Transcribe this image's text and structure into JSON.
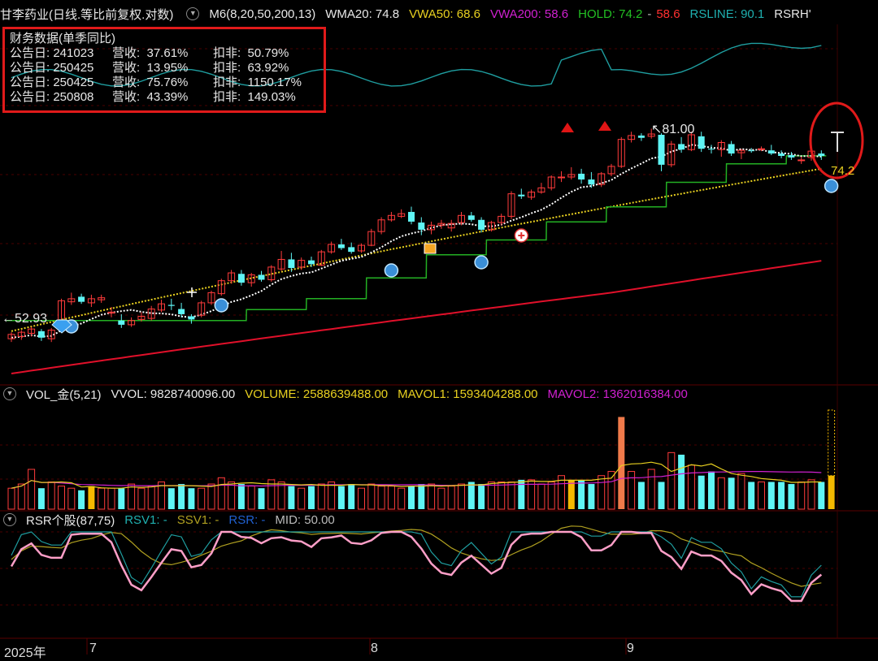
{
  "header": {
    "title": "甘李药业(日线.等比前复权.对数)",
    "m6": "M6(8,20,50,200,13)",
    "wma20": "WMA20: 74.8",
    "vwa50": "VWA50: 68.6",
    "vwa200": "VWA200: 58.6",
    "hold_a": "HOLD: 74.2",
    "hold_b": "58.6",
    "rsline": "RSLINE: 90.1",
    "rsrh": "RSRH'"
  },
  "financial": {
    "title": "财务数据(单季同比)",
    "rows": [
      {
        "date": "公告日: 241023",
        "rev": "营收:  37.61%",
        "np": "扣非:  50.79%"
      },
      {
        "date": "公告日: 250425",
        "rev": "营收:  13.95%",
        "np": "扣非:  63.92%"
      },
      {
        "date": "公告日: 250425",
        "rev": "营收:  75.76%",
        "np": "扣非:  1150.17%"
      },
      {
        "date": "公告日: 250808",
        "rev": "营收:  43.39%",
        "np": "扣非:  149.03%"
      }
    ]
  },
  "annotations": {
    "high": "81.00",
    "low": "52.93",
    "last": "74.2"
  },
  "volume": {
    "label": "VOL_金(5,21)",
    "vvol": "VVOL: 9828740096.00",
    "volume": "VOLUME: 2588639488.00",
    "mavol1": "MAVOL1: 1593404288.00",
    "mavol2": "MAVOL2: 1362016384.00"
  },
  "rsr": {
    "label": "RSR个股(87,75)",
    "rsv1": "RSV1: -",
    "ssv1": "SSV1: -",
    "rsr": "RSR: -",
    "mid": "MID: 50.00"
  },
  "xaxis": {
    "year": "2025年",
    "m7": "7",
    "m8": "8",
    "m9": "9"
  },
  "colors": {
    "up": "#ff3b3b",
    "down": "#5ff5f5",
    "ma8": "#ffffff",
    "ma20": "#23b023",
    "ma50": "#e8d020",
    "ma200": "#e0102a",
    "rsline": "#1f9ea0"
  },
  "chart_data": {
    "type": "candlestick",
    "ylim": [
      50,
      92
    ],
    "candles": [
      [
        53.8,
        54.4,
        53.5,
        54.2
      ],
      [
        54.0,
        54.6,
        53.7,
        54.4
      ],
      [
        54.3,
        54.9,
        54.0,
        54.7
      ],
      [
        54.5,
        54.7,
        53.6,
        53.9
      ],
      [
        53.8,
        54.8,
        53.5,
        54.6
      ],
      [
        54.6,
        57.6,
        54.4,
        57.4
      ],
      [
        57.3,
        58.2,
        57.0,
        57.6
      ],
      [
        57.8,
        58.1,
        57.1,
        57.3
      ],
      [
        57.2,
        58.0,
        56.8,
        57.6
      ],
      [
        57.5,
        58.0,
        57.2,
        57.7
      ],
      [
        56.2,
        56.8,
        55.8,
        56.3
      ],
      [
        55.5,
        56.1,
        54.8,
        55.1
      ],
      [
        55.1,
        55.8,
        54.9,
        55.5
      ],
      [
        55.6,
        56.3,
        55.4,
        55.9
      ],
      [
        55.7,
        56.9,
        55.5,
        56.6
      ],
      [
        56.5,
        57.5,
        56.3,
        57.1
      ],
      [
        57.0,
        57.6,
        56.5,
        56.9
      ],
      [
        56.6,
        57.2,
        55.8,
        56.1
      ],
      [
        55.9,
        56.1,
        55.2,
        55.6
      ],
      [
        56.0,
        57.4,
        55.8,
        57.2
      ],
      [
        57.2,
        58.4,
        57.0,
        58.2
      ],
      [
        58.1,
        59.6,
        57.9,
        59.4
      ],
      [
        59.4,
        60.5,
        59.1,
        60.2
      ],
      [
        60.1,
        60.5,
        58.9,
        59.2
      ],
      [
        59.2,
        60.2,
        58.8,
        60.0
      ],
      [
        60.0,
        60.4,
        59.3,
        59.5
      ],
      [
        59.5,
        61.0,
        59.3,
        60.8
      ],
      [
        60.6,
        62.5,
        60.4,
        61.6
      ],
      [
        61.6,
        62.3,
        60.3,
        60.7
      ],
      [
        60.8,
        61.8,
        60.5,
        61.5
      ],
      [
        61.5,
        61.9,
        60.8,
        61.1
      ],
      [
        61.0,
        62.6,
        60.9,
        62.4
      ],
      [
        62.4,
        63.5,
        62.2,
        63.2
      ],
      [
        63.2,
        63.8,
        62.6,
        62.8
      ],
      [
        62.9,
        63.4,
        62.2,
        62.4
      ],
      [
        62.5,
        63.3,
        62.3,
        63.1
      ],
      [
        63.1,
        64.9,
        63.0,
        64.6
      ],
      [
        64.6,
        66.2,
        64.3,
        65.9
      ],
      [
        65.9,
        66.8,
        65.7,
        66.4
      ],
      [
        66.3,
        67.1,
        66.1,
        66.6
      ],
      [
        66.8,
        67.4,
        65.4,
        65.7
      ],
      [
        65.6,
        66.2,
        64.2,
        64.8
      ],
      [
        64.8,
        65.7,
        64.3,
        65.3
      ],
      [
        65.3,
        65.9,
        64.9,
        65.5
      ],
      [
        65.0,
        65.9,
        64.6,
        65.5
      ],
      [
        65.6,
        66.8,
        65.3,
        66.4
      ],
      [
        66.4,
        66.8,
        65.7,
        65.9
      ],
      [
        65.9,
        66.2,
        64.5,
        64.8
      ],
      [
        64.8,
        65.8,
        64.6,
        65.6
      ],
      [
        65.6,
        66.6,
        65.3,
        66.3
      ],
      [
        66.3,
        69.2,
        66.0,
        68.9
      ],
      [
        68.8,
        69.5,
        68.3,
        68.6
      ],
      [
        68.5,
        69.4,
        68.2,
        69.1
      ],
      [
        69.1,
        70.2,
        68.9,
        69.6
      ],
      [
        69.6,
        71.1,
        69.3,
        70.9
      ],
      [
        70.8,
        71.6,
        70.3,
        70.9
      ],
      [
        70.9,
        72.1,
        70.6,
        71.2
      ],
      [
        71.3,
        71.9,
        70.1,
        70.6
      ],
      [
        70.6,
        71.5,
        69.6,
        70.0
      ],
      [
        70.0,
        71.5,
        69.7,
        71.3
      ],
      [
        71.3,
        72.5,
        71.0,
        72.2
      ],
      [
        72.2,
        75.9,
        72.0,
        75.6
      ],
      [
        75.6,
        76.6,
        75.2,
        76.1
      ],
      [
        76.1,
        76.4,
        75.4,
        75.8
      ],
      [
        76.0,
        77.0,
        75.7,
        76.3
      ],
      [
        76.2,
        76.4,
        71.6,
        72.4
      ],
      [
        72.4,
        75.4,
        72.1,
        75.0
      ],
      [
        75.0,
        75.9,
        73.9,
        74.3
      ],
      [
        74.3,
        76.6,
        74.1,
        76.2
      ],
      [
        76.0,
        76.6,
        74.0,
        74.4
      ],
      [
        74.4,
        74.9,
        73.8,
        74.3
      ],
      [
        74.3,
        75.5,
        73.4,
        75.2
      ],
      [
        75.0,
        75.4,
        73.5,
        73.8
      ],
      [
        73.9,
        74.4,
        73.1,
        74.2
      ],
      [
        74.2,
        74.5,
        73.9,
        74.1
      ],
      [
        74.3,
        74.7,
        74.1,
        74.4
      ],
      [
        74.2,
        74.9,
        73.6,
        73.8
      ],
      [
        73.8,
        74.2,
        73.2,
        73.5
      ],
      [
        73.6,
        74.0,
        73.0,
        73.3
      ],
      [
        73.0,
        73.4,
        72.5,
        73.0
      ],
      [
        73.3,
        74.4,
        72.9,
        74.1
      ],
      [
        73.8,
        74.2,
        73.0,
        73.5
      ]
    ],
    "volumes": [
      1.0,
      1.2,
      1.9,
      1.0,
      1.3,
      1.1,
      1.0,
      0.9,
      1.1,
      1.0,
      1.0,
      1.0,
      1.2,
      1.0,
      1.1,
      1.3,
      1.0,
      1.2,
      1.0,
      1.0,
      1.2,
      1.5,
      1.3,
      1.2,
      1.1,
      1.0,
      1.4,
      1.3,
      1.1,
      1.0,
      1.1,
      1.2,
      1.3,
      1.1,
      1.2,
      1.0,
      1.2,
      1.1,
      1.1,
      1.0,
      1.1,
      1.2,
      1.2,
      1.0,
      1.1,
      1.2,
      1.3,
      1.2,
      1.3,
      1.3,
      1.3,
      1.4,
      1.4,
      1.2,
      1.3,
      1.6,
      1.4,
      1.4,
      1.2,
      1.6,
      1.8,
      4.4,
      1.8,
      1.3,
      1.9,
      1.3,
      2.7,
      2.6,
      2.1,
      1.6,
      1.8,
      1.5,
      1.5,
      1.7,
      1.3,
      1.3,
      1.3,
      1.3,
      1.2,
      1.3,
      1.4,
      1.3
    ]
  }
}
